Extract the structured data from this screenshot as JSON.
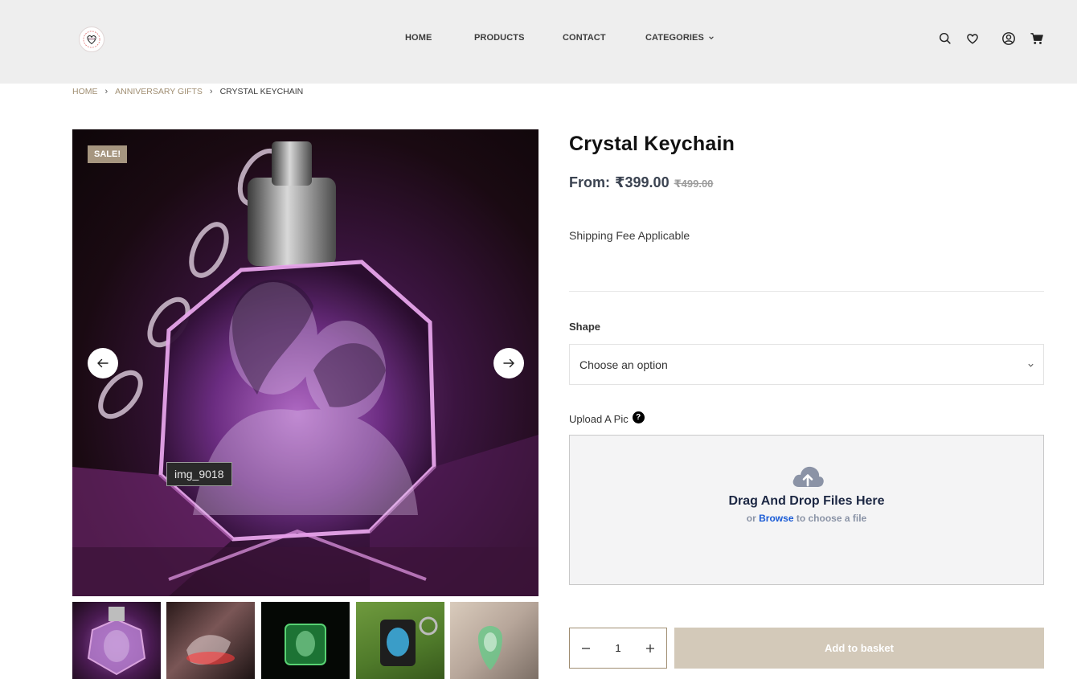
{
  "header": {
    "logo_icon": "heart-logo-icon",
    "nav": [
      {
        "label": "HOME"
      },
      {
        "label": "PRODUCTS"
      },
      {
        "label": "CONTACT"
      },
      {
        "label": "CATEGORIES",
        "icon": "chevron-down-icon"
      }
    ],
    "icons": [
      "search-icon",
      "heart-icon",
      "account-icon",
      "cart-icon"
    ]
  },
  "breadcrumb": {
    "items": [
      "HOME",
      "ANNIVERSARY GIFTS"
    ],
    "current": "CRYSTAL KEYCHAIN"
  },
  "gallery": {
    "sale_badge": "SALE!",
    "tooltip": "img_9018",
    "prev_icon": "arrow-left-icon",
    "next_icon": "arrow-right-icon",
    "thumbnail_count": 5
  },
  "product": {
    "title": "Crystal Keychain",
    "price_prefix": "From:",
    "price": "₹399.00",
    "old_price": "₹499.00",
    "shipping": "Shipping Fee Applicable"
  },
  "options": {
    "shape_label": "Shape",
    "shape_value": "Choose an option",
    "upload_label": "Upload A Pic",
    "help_icon": "?",
    "dropzone_title": "Drag And Drop Files Here",
    "dropzone_or": "or",
    "dropzone_browse": "Browse",
    "dropzone_suffix": "to choose a file"
  },
  "cart": {
    "quantity": "1",
    "add_label": "Add to basket"
  },
  "colors": {
    "accent": "#a08e72",
    "sale_badge": "#a69680",
    "basket_button": "#d3c9b9",
    "header_bg": "#eeeeee",
    "browse_link": "#1a5bd6"
  }
}
